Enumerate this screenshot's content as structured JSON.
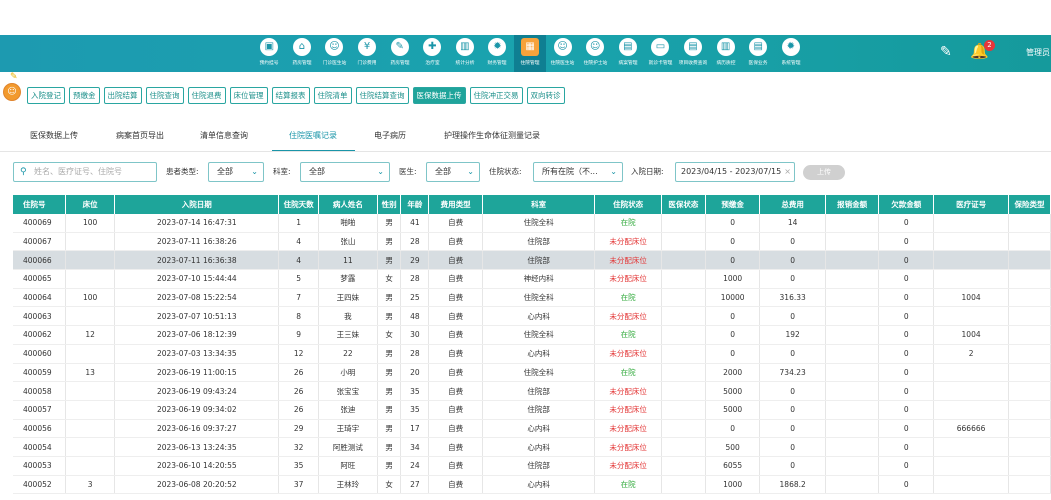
{
  "nav": [
    {
      "label": "预约挂号",
      "icon": "calendar-icon",
      "glyph": "▣"
    },
    {
      "label": "药房管理",
      "icon": "pharmacy-icon",
      "glyph": "⌂"
    },
    {
      "label": "门诊医生站",
      "icon": "doctor-icon",
      "glyph": "☺"
    },
    {
      "label": "门诊费用",
      "icon": "coin-icon",
      "glyph": "¥"
    },
    {
      "label": "药房管理",
      "icon": "pill-icon",
      "glyph": "✎"
    },
    {
      "label": "治疗室",
      "icon": "treatment-icon",
      "glyph": "✚"
    },
    {
      "label": "统计分析",
      "icon": "chart-icon",
      "glyph": "▥"
    },
    {
      "label": "财务管理",
      "icon": "finance-icon",
      "glyph": "✹"
    },
    {
      "label": "住院管理",
      "icon": "hospital-icon",
      "glyph": "▦",
      "active": true
    },
    {
      "label": "住院医生站",
      "icon": "inpatient-doctor-icon",
      "glyph": "☺"
    },
    {
      "label": "住院护士站",
      "icon": "nurse-icon",
      "glyph": "☺"
    },
    {
      "label": "病案管理",
      "icon": "record-icon",
      "glyph": "▤"
    },
    {
      "label": "就诊卡管理",
      "icon": "card-icon",
      "glyph": "▭"
    },
    {
      "label": "项目收费查询",
      "icon": "query-icon",
      "glyph": "▤"
    },
    {
      "label": "病历质控",
      "icon": "quality-icon",
      "glyph": "▥"
    },
    {
      "label": "医保业务",
      "icon": "insurance-icon",
      "glyph": "▤"
    },
    {
      "label": "系统管理",
      "icon": "settings-icon",
      "glyph": "✹"
    }
  ],
  "header": {
    "user": "管理员",
    "bell_count": "2"
  },
  "funcbar": [
    {
      "label": "入院登记"
    },
    {
      "label": "预缴金"
    },
    {
      "label": "出院结算"
    },
    {
      "label": "住院查询"
    },
    {
      "label": "住院退费"
    },
    {
      "label": "床位管理"
    },
    {
      "label": "结算报表"
    },
    {
      "label": "住院清单"
    },
    {
      "label": "住院结算查询"
    },
    {
      "label": "医保数据上传",
      "active": true
    },
    {
      "label": "住院冲正交易"
    },
    {
      "label": "双向转诊"
    }
  ],
  "tabs": [
    {
      "label": "医保数据上传"
    },
    {
      "label": "病案首页导出"
    },
    {
      "label": "清单信息查询"
    },
    {
      "label": "住院医嘱记录",
      "active": true
    },
    {
      "label": "电子病历"
    },
    {
      "label": "护理操作生命体征测量记录"
    }
  ],
  "filters": {
    "search_placeholder": "姓名、医疗证号、住院号",
    "patient_type_label": "患者类型:",
    "patient_type_value": "全部",
    "dept_label": "科室:",
    "dept_value": "全部",
    "doctor_label": "医生:",
    "doctor_value": "全部",
    "status_label": "住院状态:",
    "status_value": "所有在院（不...",
    "date_label": "入院日期:",
    "date_value": "2023/04/15 - 2023/07/15",
    "date_clear": "×",
    "upload_label": "上传"
  },
  "table": {
    "headers": [
      "住院号",
      "床位",
      "入院日期",
      "住院天数",
      "病人姓名",
      "性别",
      "年龄",
      "费用类型",
      "科室",
      "住院状态",
      "医保状态",
      "预缴金",
      "总费用",
      "报销金额",
      "欠款金额",
      "医疗证号",
      "保险类型"
    ],
    "rows": [
      [
        "400069",
        "100",
        "2023-07-14 16:47:31",
        "1",
        "啪啪",
        "男",
        "41",
        "自费",
        "住院全科",
        "在院",
        "",
        "0",
        "14",
        "",
        "0",
        "",
        ""
      ],
      [
        "400067",
        "",
        "2023-07-11 16:38:26",
        "4",
        "张山",
        "男",
        "28",
        "自费",
        "住院部",
        "未分配床位",
        "",
        "0",
        "0",
        "",
        "0",
        "",
        ""
      ],
      [
        "400066",
        "",
        "2023-07-11 16:36:38",
        "4",
        "11",
        "男",
        "29",
        "自费",
        "住院部",
        "未分配床位",
        "",
        "0",
        "0",
        "",
        "0",
        "",
        ""
      ],
      [
        "400065",
        "",
        "2023-07-10 15:44:44",
        "5",
        "梦露",
        "女",
        "28",
        "自费",
        "神经内科",
        "未分配床位",
        "",
        "1000",
        "0",
        "",
        "0",
        "",
        ""
      ],
      [
        "400064",
        "100",
        "2023-07-08 15:22:54",
        "7",
        "王四妹",
        "男",
        "25",
        "自费",
        "住院全科",
        "在院",
        "",
        "10000",
        "316.33",
        "",
        "0",
        "1004",
        ""
      ],
      [
        "400063",
        "",
        "2023-07-07 10:51:13",
        "8",
        "我",
        "男",
        "48",
        "自费",
        "心内科",
        "未分配床位",
        "",
        "0",
        "0",
        "",
        "0",
        "",
        ""
      ],
      [
        "400062",
        "12",
        "2023-07-06 18:12:39",
        "9",
        "王三妹",
        "女",
        "30",
        "自费",
        "住院全科",
        "在院",
        "",
        "0",
        "192",
        "",
        "0",
        "1004",
        ""
      ],
      [
        "400060",
        "",
        "2023-07-03 13:34:35",
        "12",
        "22",
        "男",
        "28",
        "自费",
        "心内科",
        "未分配床位",
        "",
        "0",
        "0",
        "",
        "0",
        "2",
        ""
      ],
      [
        "400059",
        "13",
        "2023-06-19 11:00:15",
        "26",
        "小明",
        "男",
        "20",
        "自费",
        "住院全科",
        "在院",
        "",
        "2000",
        "734.23",
        "",
        "0",
        "",
        ""
      ],
      [
        "400058",
        "",
        "2023-06-19 09:43:24",
        "26",
        "张宝宝",
        "男",
        "35",
        "自费",
        "住院部",
        "未分配床位",
        "",
        "5000",
        "0",
        "",
        "0",
        "",
        ""
      ],
      [
        "400057",
        "",
        "2023-06-19 09:34:02",
        "26",
        "张迪",
        "男",
        "35",
        "自费",
        "住院部",
        "未分配床位",
        "",
        "5000",
        "0",
        "",
        "0",
        "",
        ""
      ],
      [
        "400056",
        "",
        "2023-06-16 09:37:27",
        "29",
        "王琦宇",
        "男",
        "17",
        "自费",
        "心内科",
        "未分配床位",
        "",
        "0",
        "0",
        "",
        "0",
        "666666",
        ""
      ],
      [
        "400054",
        "",
        "2023-06-13 13:24:35",
        "32",
        "阿胜测试",
        "男",
        "34",
        "自费",
        "心内科",
        "未分配床位",
        "",
        "500",
        "0",
        "",
        "0",
        "",
        ""
      ],
      [
        "400053",
        "",
        "2023-06-10 14:20:55",
        "35",
        "阿旺",
        "男",
        "24",
        "自费",
        "住院部",
        "未分配床位",
        "",
        "6055",
        "0",
        "",
        "0",
        "",
        ""
      ],
      [
        "400052",
        "3",
        "2023-06-08 20:20:52",
        "37",
        "王林玲",
        "女",
        "27",
        "自费",
        "心内科",
        "在院",
        "",
        "1000",
        "1868.2",
        "",
        "0",
        "",
        ""
      ]
    ],
    "selected_row": 2
  },
  "colors": {
    "teal": "#1ea59a",
    "in_hospital": "#2fa93a",
    "unassigned": "#e33434"
  }
}
